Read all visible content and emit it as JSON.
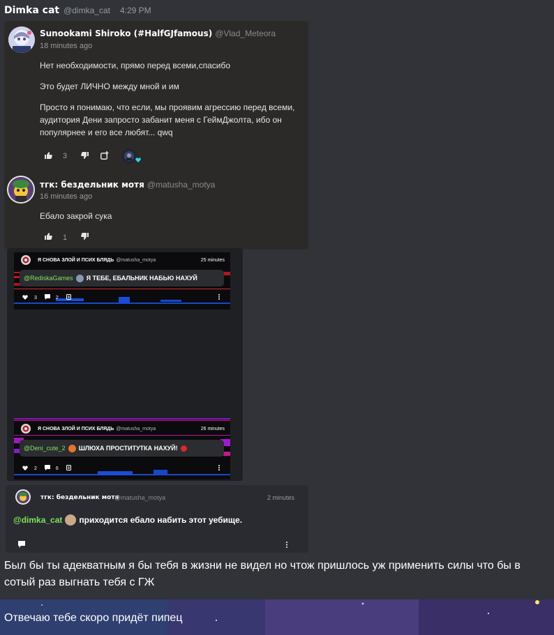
{
  "message": {
    "author": "Dimka cat",
    "handle": "@dimka_cat",
    "time": "4:29 PM"
  },
  "post": {
    "comments": [
      {
        "author": "Sunookami Shiroko (#HalfGJfamous)",
        "handle": "@Vlad_Meteora",
        "time": "18 minutes ago",
        "paragraphs": [
          "Нет необходимости, прямо перед всеми,спасибо",
          "Это будет ЛИЧНО между мной и им",
          "Просто я понимаю, что если, мы проявим агрессию перед всеми, аудитория Дени запросто забанит меня с ГеймДжолта, ибо он популярнее и его все любят... qwq"
        ],
        "likes": "3"
      },
      {
        "author": "тгк: бездельник мотя",
        "handle": "@matusha_motya",
        "time": "16 minutes ago",
        "paragraphs": [
          "Ебало закрой сука"
        ],
        "likes": "1"
      }
    ]
  },
  "reposts": [
    {
      "title": "Я СНОВА ЗЛОЙ И ПСИХ БЛЯДЬ",
      "handle": "@matusha_motya",
      "time": "25 minutes",
      "mention": "@RediskaGames",
      "text": "Я ТЕБЕ, ЕБАЛЬНИК НАБЬЮ НАХУЙ",
      "likes": "3",
      "comments": "2"
    },
    {
      "title": "Я СНОВА ЗЛОЙ И ПСИХ БЛЯДЬ",
      "handle": "@matusha_motya",
      "time": "26 minutes",
      "mention": "@Deni_cute_2",
      "text": "ШЛЮХА ПРОСТИТУТКА НАХУЙ!",
      "likes": "2",
      "comments": "6"
    }
  ],
  "reply_card": {
    "author": "тгк: бездельник мотя",
    "handle": "@matusha_motya",
    "time": "2 minutes",
    "mention": "@dimka_cat",
    "text": "приходится ебало набить этот уебище."
  },
  "body_text": "Был бы ты адекватным я бы тебя в жизни не видел но чтож пришлось уж применить силы что бы в сотый раз выгнать тебя с ГЖ",
  "footer_text": "Отвечаю тебе скоро придёт пипец",
  "icons": {
    "like": "thumbs-up-icon",
    "dislike": "thumbs-down-icon",
    "share": "share-icon",
    "comment": "comment-icon",
    "heart": "heart-icon",
    "more": "more-vertical-icon"
  },
  "colors": {
    "mention": "#7ee35c",
    "card": "#2b2a29",
    "background": "#313338"
  }
}
